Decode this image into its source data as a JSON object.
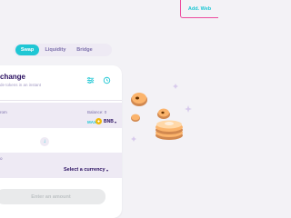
{
  "header": {
    "wallet_button": "Add. Web"
  },
  "tabs": [
    {
      "label": "Swap",
      "active": true
    },
    {
      "label": "Liquidity",
      "active": false
    },
    {
      "label": "Bridge",
      "active": false
    }
  ],
  "card": {
    "title": "change",
    "subtitle": "de tokens in an instant",
    "settings_icon": "sliders-icon",
    "history_icon": "history-icon"
  },
  "from": {
    "label": "rom",
    "balance": "Balance: 0",
    "max": "MAX",
    "token": "BNB"
  },
  "to": {
    "label": "o",
    "select": "Select a currency"
  },
  "action_button": "Enter an amount",
  "colors": {
    "primary": "#1fc7d4",
    "text": "#280d5f",
    "muted": "#7a6eaa",
    "outline": "#ed4b9e"
  }
}
